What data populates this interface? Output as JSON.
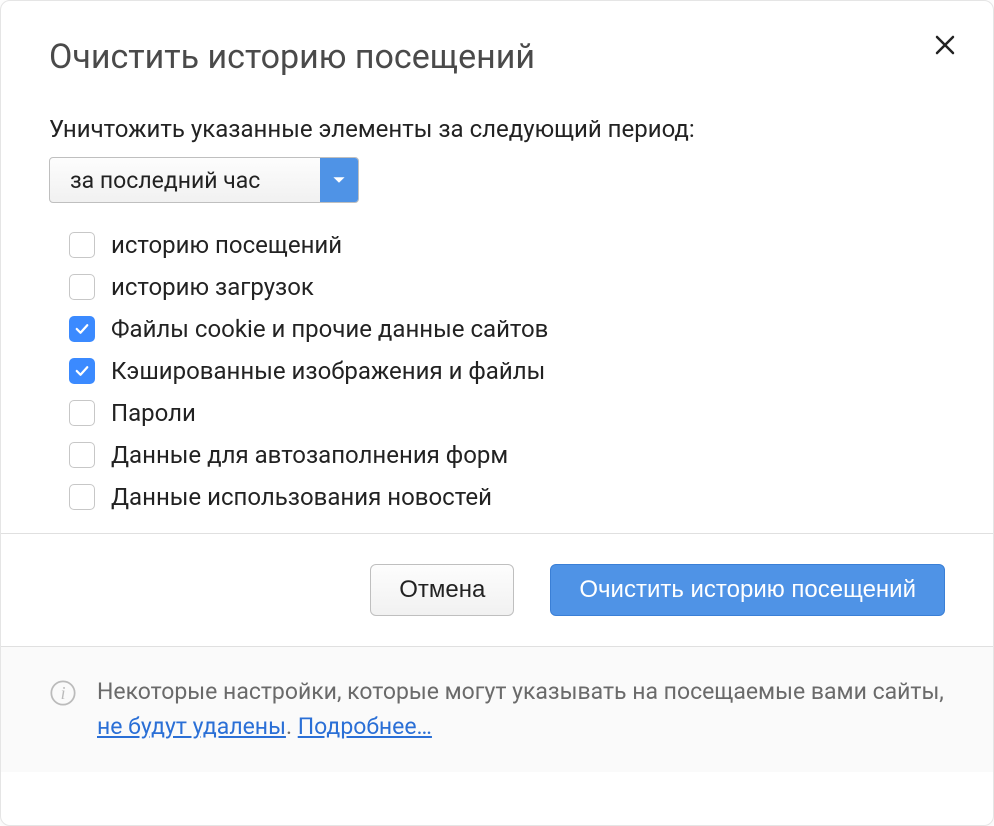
{
  "dialog": {
    "title": "Очистить историю посещений",
    "prompt": "Уничтожить указанные элементы за следующий период:",
    "period_select": {
      "selected": "за последний час"
    },
    "options": [
      {
        "label": "историю посещений",
        "checked": false
      },
      {
        "label": "историю загрузок",
        "checked": false
      },
      {
        "label": "Файлы cookie и прочие данные сайтов",
        "checked": true
      },
      {
        "label": "Кэшированные изображения и файлы",
        "checked": true
      },
      {
        "label": "Пароли",
        "checked": false
      },
      {
        "label": "Данные для автозаполнения форм",
        "checked": false
      },
      {
        "label": "Данные использования новостей",
        "checked": false
      }
    ],
    "buttons": {
      "cancel": "Отмена",
      "confirm": "Очистить историю посещений"
    },
    "info": {
      "text_before": "Некоторые настройки, которые могут указывать на посещаемые вами сайты, ",
      "link1": "не будут удалены",
      "text_middle": ". ",
      "link2": "Подробнее…"
    }
  },
  "colors": {
    "accent": "#4f93e6",
    "link": "#2a6fd6"
  }
}
